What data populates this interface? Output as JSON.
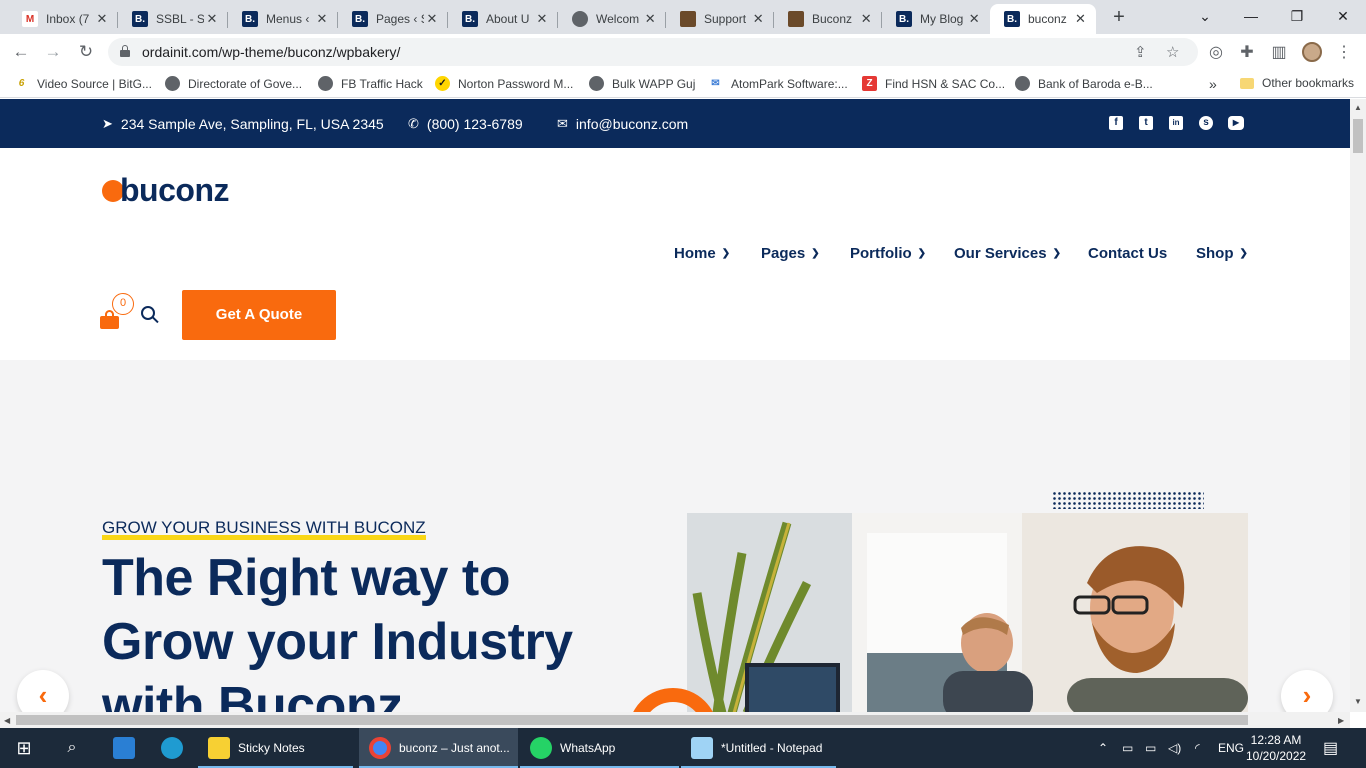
{
  "browser": {
    "tabs": [
      {
        "label": "Inbox (7",
        "fav_text": "M",
        "fav_color": "#ffffff",
        "fav_fg": "#d93025"
      },
      {
        "label": "SSBL - S",
        "fav_text": "B.",
        "fav_color": "#0b2a5b",
        "fav_fg": "#ffffff"
      },
      {
        "label": "Menus ‹",
        "fav_text": "B.",
        "fav_color": "#0b2a5b",
        "fav_fg": "#ffffff"
      },
      {
        "label": "Pages ‹ S",
        "fav_text": "B.",
        "fav_color": "#0b2a5b",
        "fav_fg": "#ffffff"
      },
      {
        "label": "About U",
        "fav_text": "B.",
        "fav_color": "#0b2a5b",
        "fav_fg": "#ffffff"
      },
      {
        "label": "Welcom",
        "fav_text": "◉",
        "fav_color": "#5f6368",
        "fav_fg": "#ffffff"
      },
      {
        "label": "Support",
        "fav_text": "",
        "fav_color": "#6b4a2a",
        "fav_fg": "#ffffff"
      },
      {
        "label": "Buconz",
        "fav_text": "",
        "fav_color": "#6b4a2a",
        "fav_fg": "#ffffff"
      },
      {
        "label": "My Blog",
        "fav_text": "B.",
        "fav_color": "#0b2a5b",
        "fav_fg": "#ffffff"
      },
      {
        "label": "buconz",
        "fav_text": "B.",
        "fav_color": "#0b2a5b",
        "fav_fg": "#ffffff"
      }
    ],
    "close_glyph": "✕",
    "new_tab_glyph": "+",
    "url": "ordainit.com/wp-theme/buconz/wpbakery/",
    "bookmarks": [
      {
        "label": "Video Source | BitG...",
        "icon": "6",
        "color": "#ffffff",
        "fg": "#c8a000"
      },
      {
        "label": "Directorate of Gove...",
        "icon": "◉",
        "color": "#5f6368",
        "fg": "#ffffff"
      },
      {
        "label": "FB Traffic Hack",
        "icon": "◉",
        "color": "#5f6368",
        "fg": "#ffffff"
      },
      {
        "label": "Norton Password M...",
        "icon": "✓",
        "color": "#ffd600",
        "fg": "#1a1a1a"
      },
      {
        "label": "Bulk WAPP Guj",
        "icon": "◉",
        "color": "#5f6368",
        "fg": "#ffffff"
      },
      {
        "label": "AtomPark Software:...",
        "icon": "✉",
        "color": "#ffffff",
        "fg": "#3a7bd5"
      },
      {
        "label": "Find HSN & SAC Co...",
        "icon": "Z",
        "color": "#e53935",
        "fg": "#ffffff"
      },
      {
        "label": "Bank of Baroda e-B...",
        "icon": "◉",
        "color": "#5f6368",
        "fg": "#ffffff"
      }
    ],
    "more_bookmarks": "»",
    "other_bookmarks": "Other bookmarks"
  },
  "site": {
    "topbar": {
      "address": "234 Sample Ave, Sampling, FL, USA 2345",
      "phone": "(800) 123-6789",
      "email": "info@buconz.com",
      "social": [
        "f",
        "t",
        "in",
        "s",
        "▶"
      ]
    },
    "logo": "buconz",
    "menu": [
      {
        "label": "Home",
        "has_sub": true
      },
      {
        "label": "Pages",
        "has_sub": true
      },
      {
        "label": "Portfolio",
        "has_sub": true
      },
      {
        "label": "Our Services",
        "has_sub": true
      },
      {
        "label": "Contact Us",
        "has_sub": false
      },
      {
        "label": "Shop",
        "has_sub": true
      }
    ],
    "cart_count": "0",
    "quote_button": "Get A Quote",
    "hero": {
      "eyebrow": "GROW YOUR BUSINESS WITH BUCONZ",
      "headline_lines": [
        "The Right way to",
        "Grow your Industry",
        "with Buconz"
      ],
      "prev_glyph": "‹",
      "next_glyph": "›"
    }
  },
  "taskbar": {
    "apps": [
      {
        "label": "Sticky Notes",
        "icon_color": "#f7d033"
      },
      {
        "label": "buconz – Just anot...",
        "icon_color": "#4285f4"
      },
      {
        "label": "WhatsApp",
        "icon_color": "#25d366"
      },
      {
        "label": "*Untitled - Notepad",
        "icon_color": "#9fd3f5"
      }
    ],
    "lang": "ENG",
    "time": "12:28 AM",
    "date": "10/20/2022"
  },
  "colors": {
    "brand_navy": "#0b2a5b",
    "brand_orange": "#f96a0e",
    "accent_yellow": "#f9d616"
  }
}
